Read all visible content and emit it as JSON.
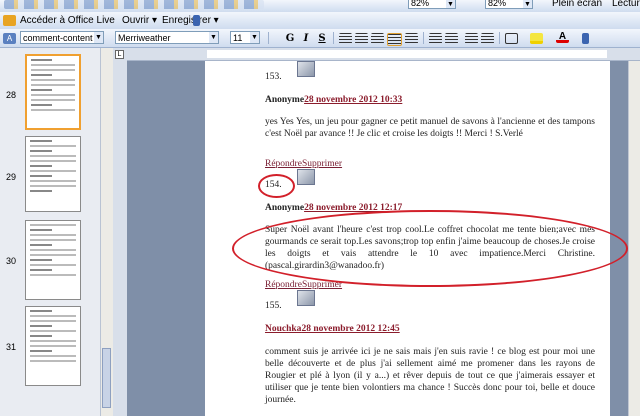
{
  "top_toolbar": {
    "zoom1": "82%",
    "zoom2": "82%",
    "fullscreen": "Plein écran",
    "read": "Lecture"
  },
  "office_bar": {
    "office_live": "Accéder à Office Live",
    "open": "Ouvrir",
    "save": "Enregistrer"
  },
  "format_bar": {
    "style": "comment-content + M",
    "font": "Merriweather",
    "size": "11",
    "bold": "G",
    "italic": "I",
    "underline": "S"
  },
  "thumbnails": {
    "pages": [
      "28",
      "29",
      "30",
      "31"
    ],
    "selected": "28"
  },
  "comments": [
    {
      "number": "153."
    },
    {
      "author": "Anonyme",
      "date": "28 novembre 2012 10:33",
      "body": "yes Yes Yes, un jeu pour gagner ce petit manuel de savons à l'ancienne et des tampons c'est Noël par avance !! Je clic et croise les doigts !! Merci ! S.Verlé",
      "reply": "Répondre",
      "delete": "Supprimer",
      "next_number": "154."
    },
    {
      "author": "Anonyme",
      "date": "28 novembre 2012 12:17",
      "body": "Super Noël avant l'heure c'est trop cool.Le coffret chocolat me tente bien;avec mes gourmands ce serait top.Les savons;trop top enfin j'aime beaucoup de choses.Je croise les doigts et vais attendre le 10 avec impatience.Merci Christine.(pascal.girardin3@wanadoo.fr)",
      "reply": "Répondre",
      "delete": "Supprimer",
      "next_number": "155."
    },
    {
      "author": "Nouchka",
      "date": "28 novembre 2012 12:45",
      "body": "comment suis je arrivée ici je ne sais mais j'en suis ravie ! ce blog est pour moi une belle découverte et de plus j'ai sellement aimé me promener dans les rayons de Rougier et plé à lyon (il y a...) et rêver depuis de tout ce que j'aimerais essayer et utiliser que je tente bien volontiers ma chance ! Succès donc pour toi, belle et douce journée."
    }
  ],
  "colors": {
    "annotation": "#d2202a",
    "date_link": "#8b1c2c",
    "selected_thumb": "#f0a030"
  }
}
